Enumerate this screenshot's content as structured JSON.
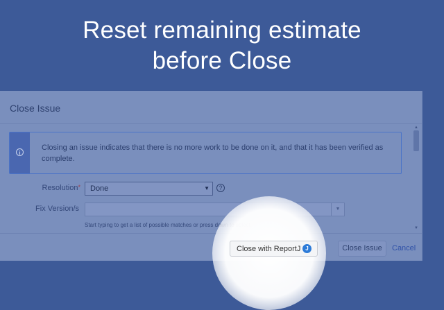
{
  "headline": {
    "line1": "Reset remaining estimate",
    "line2": "before Close"
  },
  "dialog": {
    "title": "Close Issue",
    "info_message": "Closing an issue indicates that there is no more work to be done on it, and that it has been verified as complete.",
    "fields": {
      "resolution": {
        "label": "Resolution",
        "required_marker": "*",
        "value": "Done"
      },
      "fix_versions": {
        "label": "Fix Version/s",
        "value": "",
        "hint": "Start typing to get a list of possible matches or press down to select."
      }
    },
    "footer": {
      "reportj_button": "Close with ReportJ",
      "reportj_badge": "J",
      "close_button": "Close Issue",
      "cancel_link": "Cancel"
    }
  },
  "icons": {
    "info": "info-icon",
    "help": "help-icon",
    "dropdown": "chevron-down-icon",
    "reportj": "reportj-logo-icon"
  },
  "colors": {
    "background": "#3d5a98",
    "dialog_overlay": "#7a8fbd",
    "reportj_badge": "#2d7bd8"
  }
}
